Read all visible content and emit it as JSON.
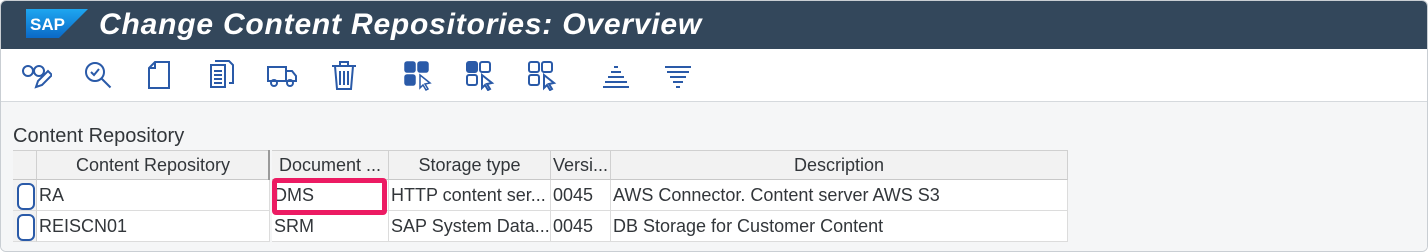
{
  "window": {
    "logo_text": "SAP",
    "title": "Change Content Repositories: Overview"
  },
  "toolbar": {
    "icons": [
      "glasses-pencil-icon",
      "inspect-icon",
      "new-document-icon",
      "copy-document-icon",
      "transport-truck-icon",
      "delete-trash-icon",
      "select-all-icon",
      "select-block-icon",
      "deselect-all-icon",
      "collapse-icon",
      "expand-icon"
    ]
  },
  "section": {
    "title": "Content Repository"
  },
  "table": {
    "columns": [
      "Content Repository",
      "Document ...",
      "Storage type",
      "Versi...",
      "Description"
    ],
    "rows": [
      [
        "RA",
        "DMS",
        "HTTP content ser...",
        "0045",
        "AWS Connector. Content server AWS S3"
      ],
      [
        "REISCN01",
        "SRM",
        "SAP System Data...",
        "0045",
        "DB Storage for Customer Content"
      ]
    ]
  },
  "colors": {
    "titlebar": "#33475b",
    "accent_icon": "#2a5aa8",
    "highlight": "#ec1b63"
  }
}
